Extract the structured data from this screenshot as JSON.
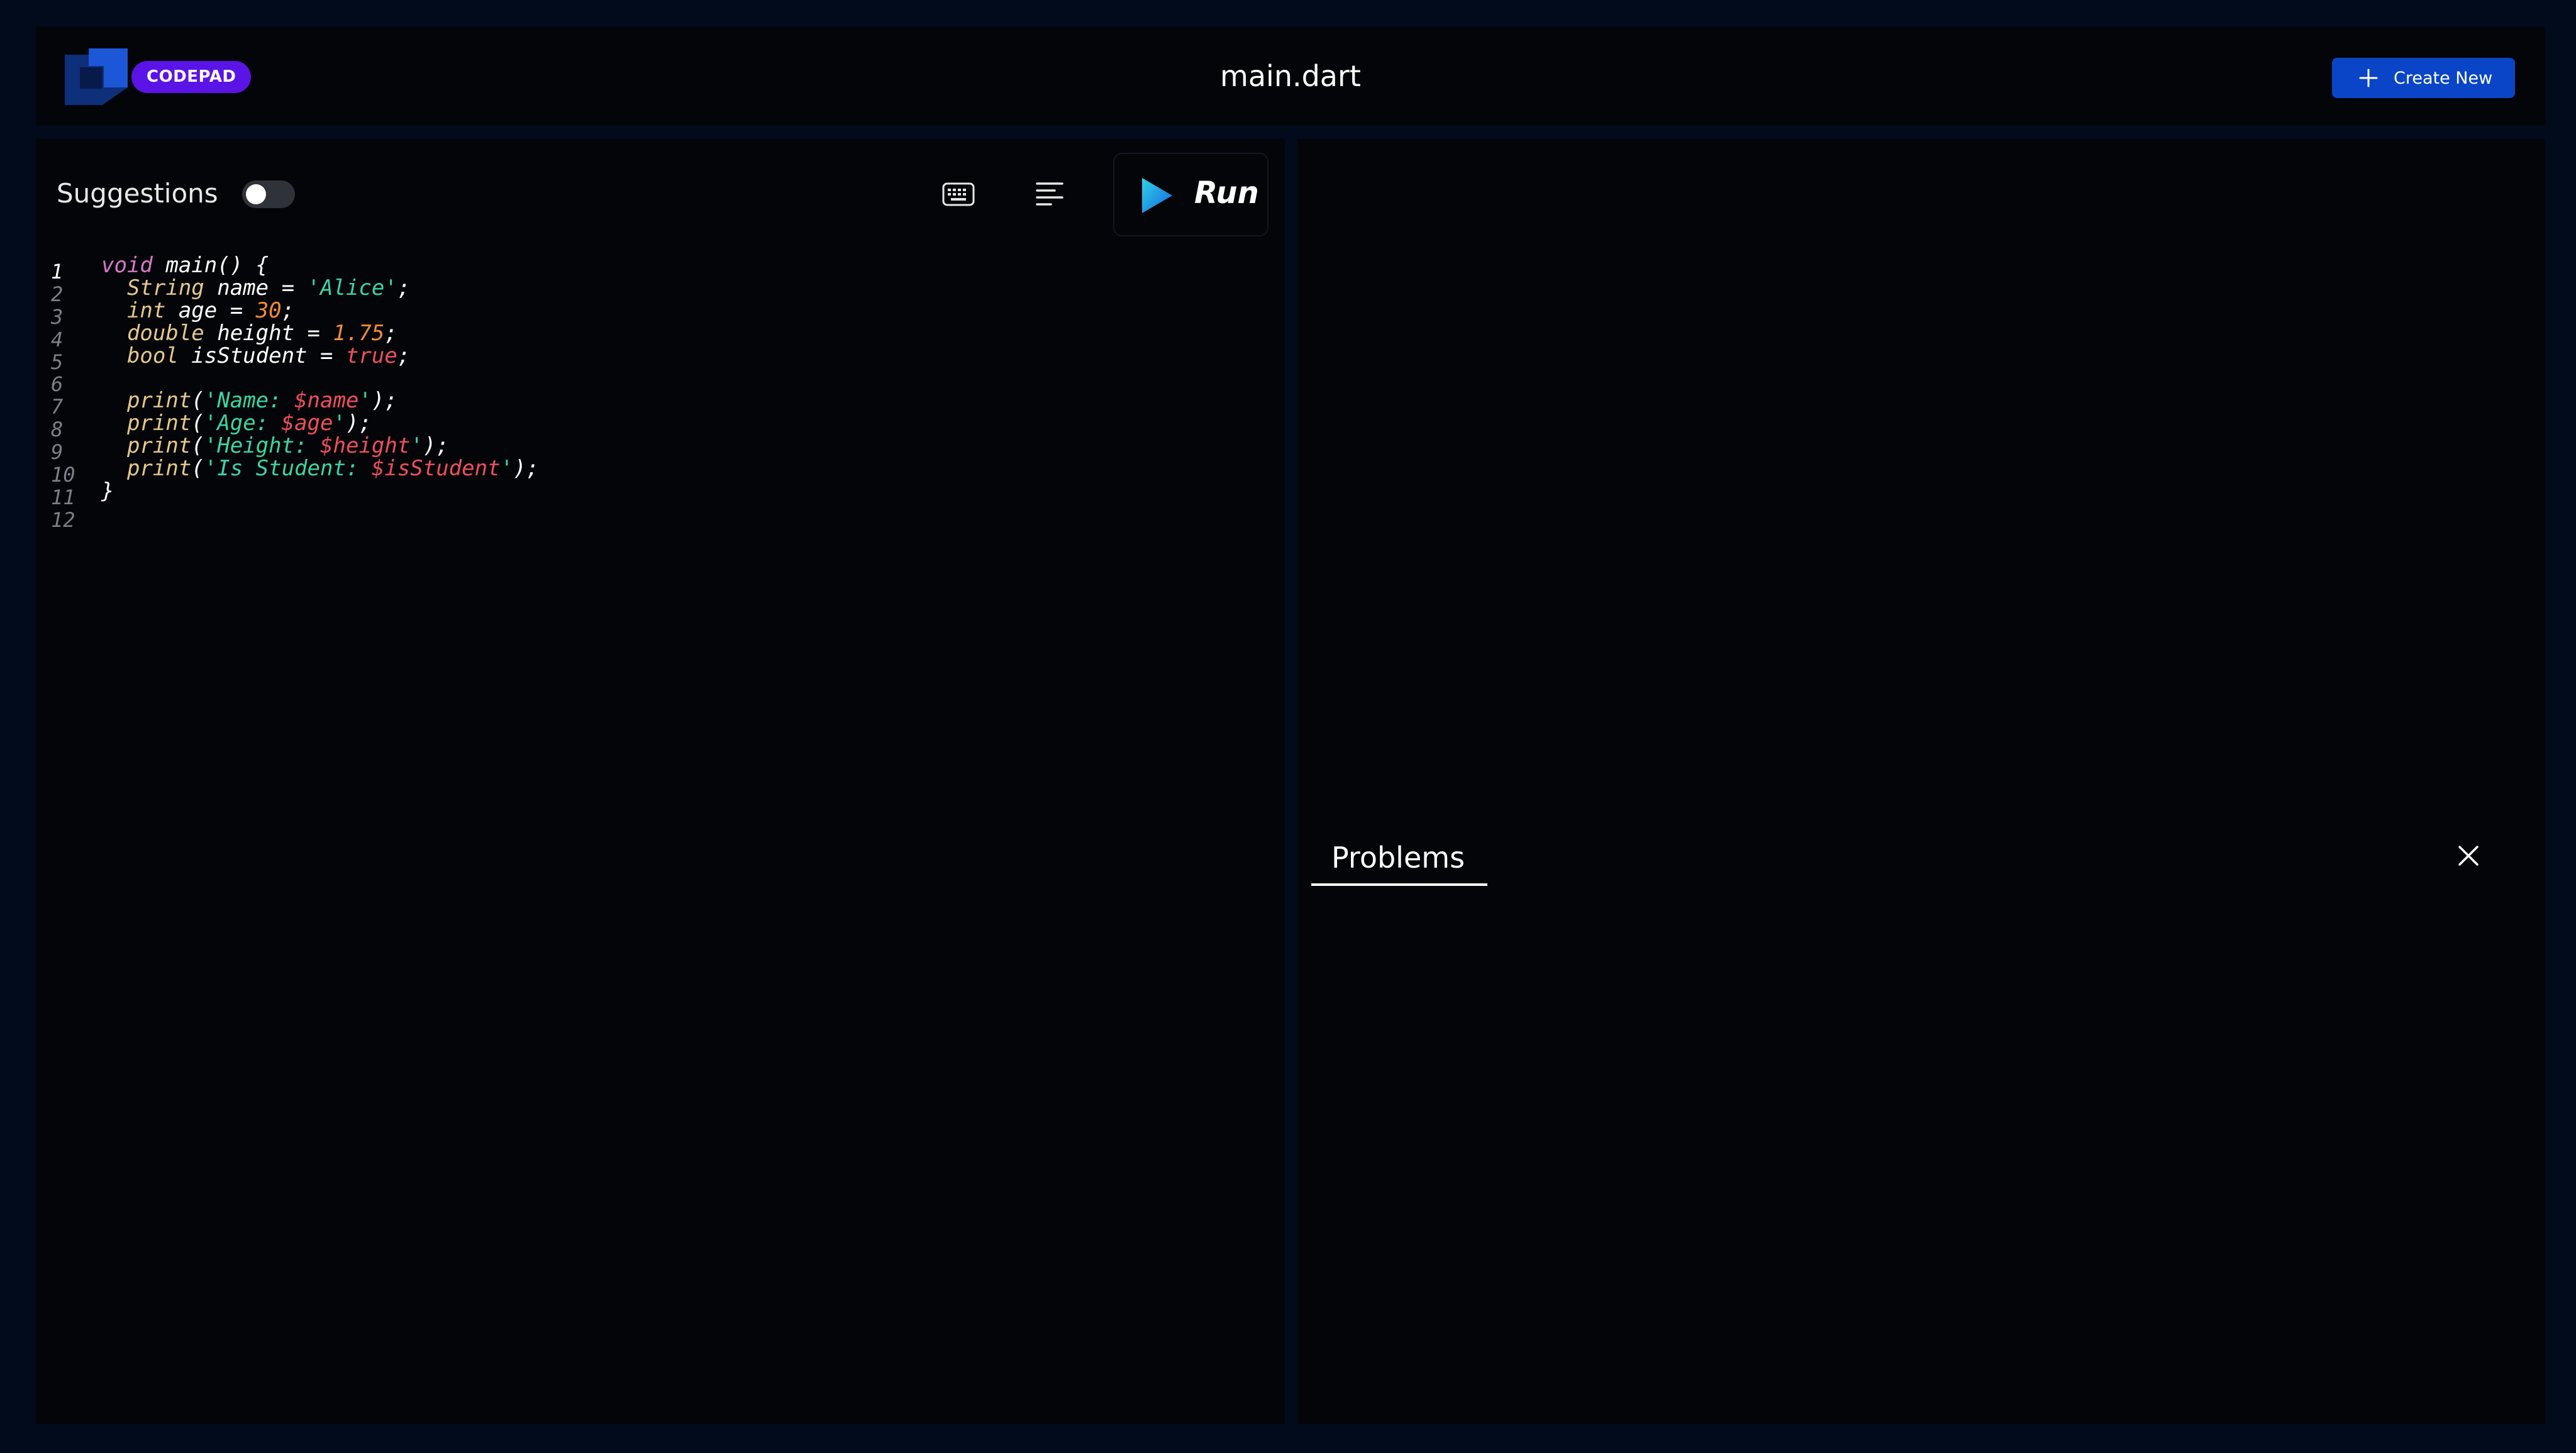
{
  "header": {
    "brand": "CODEPAD",
    "file_title": "main.dart",
    "create_label": "Create New"
  },
  "editor": {
    "suggestions_label": "Suggestions",
    "suggestions_enabled": false,
    "run_label": "Run",
    "active_line": 1,
    "lines": [
      {
        "num": "1",
        "tokens": [
          [
            "kw2",
            "void"
          ],
          [
            "",
            " main() {"
          ]
        ]
      },
      {
        "num": "2",
        "tokens": [
          [
            "kw",
            "  String"
          ],
          [
            "",
            " name = "
          ],
          [
            "str",
            "'Alice'"
          ],
          [
            "",
            ";"
          ]
        ]
      },
      {
        "num": "3",
        "tokens": [
          [
            "kw",
            "  int"
          ],
          [
            "",
            " age = "
          ],
          [
            "num",
            "30"
          ],
          [
            "",
            ";"
          ]
        ]
      },
      {
        "num": "4",
        "tokens": [
          [
            "kw",
            "  double"
          ],
          [
            "",
            " height = "
          ],
          [
            "num",
            "1.75"
          ],
          [
            "",
            ";"
          ]
        ]
      },
      {
        "num": "5",
        "tokens": [
          [
            "kw",
            "  bool"
          ],
          [
            "",
            " isStudent = "
          ],
          [
            "bool",
            "true"
          ],
          [
            "",
            ";"
          ]
        ]
      },
      {
        "num": "6",
        "tokens": []
      },
      {
        "num": "7",
        "tokens": [
          [
            "kw",
            "  print"
          ],
          [
            "",
            "("
          ],
          [
            "str",
            "'Name: "
          ],
          [
            "interp",
            "$name"
          ],
          [
            "str",
            "'"
          ],
          [
            "",
            ");"
          ]
        ]
      },
      {
        "num": "8",
        "tokens": [
          [
            "kw",
            "  print"
          ],
          [
            "",
            "("
          ],
          [
            "str",
            "'Age: "
          ],
          [
            "interp",
            "$age"
          ],
          [
            "str",
            "'"
          ],
          [
            "",
            ");"
          ]
        ]
      },
      {
        "num": "9",
        "tokens": [
          [
            "kw",
            "  print"
          ],
          [
            "",
            "("
          ],
          [
            "str",
            "'Height: "
          ],
          [
            "interp",
            "$height"
          ],
          [
            "str",
            "'"
          ],
          [
            "",
            ");"
          ]
        ]
      },
      {
        "num": "10",
        "tokens": [
          [
            "kw",
            "  print"
          ],
          [
            "",
            "("
          ],
          [
            "str",
            "'Is Student: "
          ],
          [
            "interp",
            "$isStudent"
          ],
          [
            "str",
            "'"
          ],
          [
            "",
            ");"
          ]
        ]
      },
      {
        "num": "11",
        "tokens": [
          [
            "",
            "}"
          ]
        ]
      },
      {
        "num": "12",
        "tokens": []
      }
    ]
  },
  "output": {
    "problems_label": "Problems"
  },
  "colors": {
    "background": "#020b1c",
    "panel": "#040509",
    "brand": "#5b14e6",
    "accent": "#0a45c8",
    "keyword": "#e5c889",
    "string": "#3bd6a2",
    "number": "#f28c34"
  },
  "icons": {
    "logo": "codepad-logo-icon",
    "create": "plus-icon",
    "keyboard": "keyboard-icon",
    "format": "format-lines-icon",
    "run": "play-icon",
    "close": "close-icon"
  }
}
